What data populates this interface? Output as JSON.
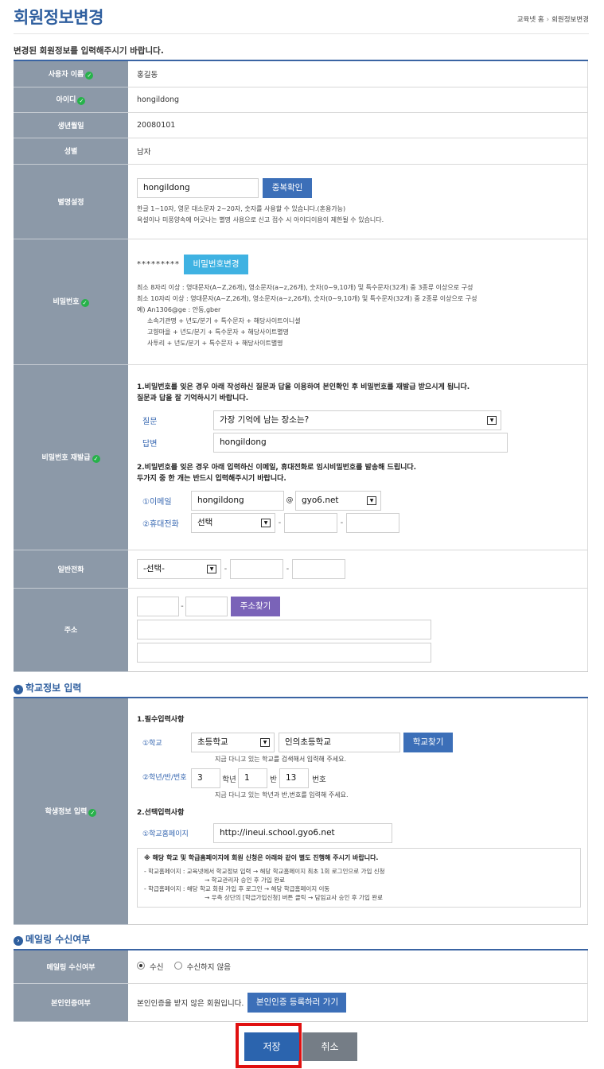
{
  "header": {
    "title": "회원정보변경",
    "breadcrumb": [
      "교육넷 홈",
      "회원정보변경"
    ],
    "intro": "변경된 회원정보를 입력해주시기 바랍니다."
  },
  "member": {
    "name_label": "사용자 이름",
    "name_value": "홍길동",
    "id_label": "아이디",
    "id_value": "hongildong",
    "birth_label": "생년월일",
    "birth_value": "20080101",
    "gender_label": "성별",
    "gender_value": "남자",
    "nick_label": "별명설정",
    "nick_value": "hongildong",
    "nick_btn": "중복확인",
    "nick_help1": "한글 1~10자, 영문 대소문자 2~20자, 숫자를 사용할 수 있습니다.(혼용가능)",
    "nick_help2": "욕설이나 미풍양속에 어긋나는 별명 사용으로 신고 접수 시 아이디이용이 제한될 수 있습니다.",
    "pw_label": "비밀번호",
    "pw_mask": "*********",
    "pw_btn": "비밀번호변경",
    "pw_help": [
      "최소 8자리 이상 : 영대문자(A~Z,26개), 영소문자(a~z,26개), 숫자(0~9,10개) 및 특수문자(32개) 중 3종류 이상으로 구성",
      "최소 10자리 이상 : 영대문자(A~Z,26개), 영소문자(a~z,26개), 숫자(0~9,10개) 및 특수문자(32개) 중 2종류 이상으로 구성",
      "예) An1306@ge : 안동,gber"
    ],
    "pw_examples": [
      "소속기관명 + 년도/분기 + 특수문자 + 해당사이트이니셜",
      "고향마을 + 년도/분기 + 특수문자 + 해당사이트별명",
      "사투리 + 년도/분기 + 특수문자 + 해당사이트별명"
    ],
    "reissue_label": "비밀번호 재발급",
    "reissue_text1a": "1.비밀번호를 잊은 경우 아래 작성하신 질문과 답을 이용하여 본인확인 후 비밀번호를 재발급 받으시게 됩니다.",
    "reissue_text1b": "질문과 답을 잘 기억하시기 바랍니다.",
    "question_label": "질문",
    "question_value": "가장 기억에 남는 장소는?",
    "answer_label": "답변",
    "answer_value": "hongildong",
    "reissue_text2a": "2.비밀번호를 잊은 경우 아래 입력하신 이메일, 휴대전화로 임시비밀번호를 발송해 드립니다.",
    "reissue_text2b": "두가지 중 한 개는 반드시 입력해주시기 바랍니다.",
    "email_label": "①이메일",
    "email_id": "hongildong",
    "email_at": "@",
    "email_domain": "gyo6.net",
    "mobile_label": "②휴대전화",
    "mobile_select": "선택",
    "phone_label": "일반전화",
    "phone_select": "-선택-",
    "address_label": "주소",
    "address_btn": "주소찾기"
  },
  "school": {
    "section_title": "학교정보 입력",
    "row_label": "학생정보 입력",
    "required_title": "1.필수입력사항",
    "school_label": "①학교",
    "school_type": "초등학교",
    "school_name": "인의초등학교",
    "school_btn": "학교찾기",
    "school_help": "지금 다니고 있는 학교를 검색해서 입력해 주세요.",
    "grade_label": "②학년/반/번호",
    "grade_value": "3",
    "grade_unit": "학년",
    "class_value": "1",
    "class_unit": "반",
    "number_value": "13",
    "number_unit": "번호",
    "grade_help": "지금 다니고 있는 학년과 반,번호를 입력해 주세요.",
    "optional_title": "2.선택입력사항",
    "homepage_label": "①학교홈페이지",
    "homepage_value": "http://ineui.school.gyo6.net",
    "notice_title": "※ 해당 학교 및 학급홈페이지에 회원 신청은 아래와 같이 별도 진행해 주시기 바랍니다.",
    "notice_lines": [
      "- 학교홈페이지 : 교육넷에서 학교정보 입력 → 해당 학교홈페이지 최초 1회 로그인으로 가입 신청",
      "→ 학교관리자 승인 후 가입 완료",
      "- 학급홈페이지 : 해당 학교 회원 가입 후 로그인 → 해당 학급홈페이지 이동",
      "→ 우측 상단의 [학급가입신청] 버튼 클릭 → 담임교사 승인 후 가입 완료"
    ]
  },
  "mailing": {
    "section_title": "메일링 수신여부",
    "row_label": "메일링 수신여부",
    "opt_yes": "수신",
    "opt_no": "수신하지 않음",
    "auth_label": "본인인증여부",
    "auth_text": "본인인증을 받지 않은 회원입니다.",
    "auth_btn": "본인인증 등록하러 가기"
  },
  "actions": {
    "save": "저장",
    "cancel": "취소"
  }
}
